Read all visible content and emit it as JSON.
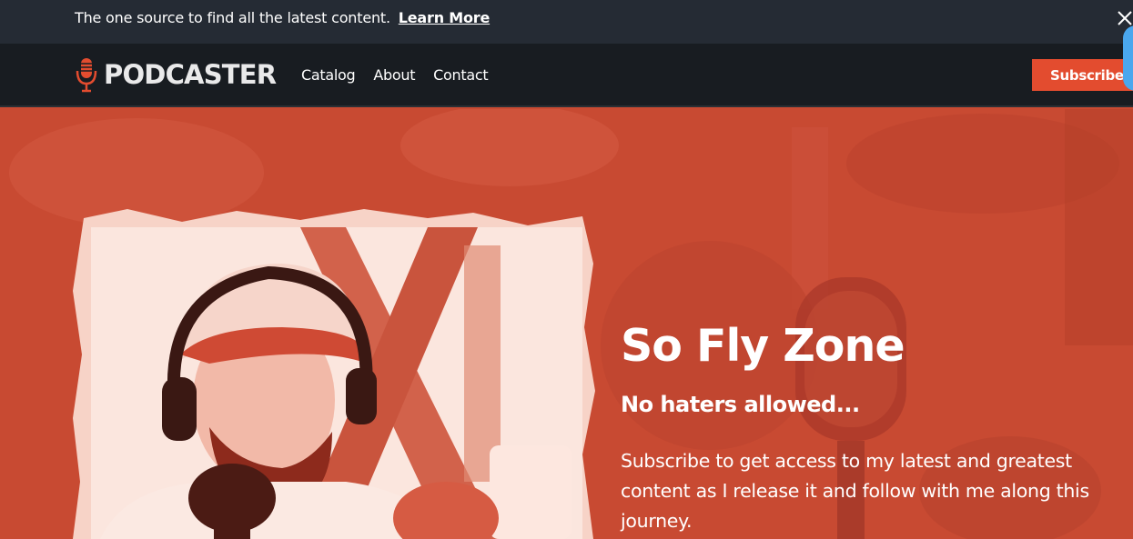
{
  "announcement": {
    "text": "The one source to find all the latest content.",
    "link_label": "Learn More"
  },
  "navbar": {
    "logo_text": "PODCASTER",
    "links": [
      {
        "label": "Catalog"
      },
      {
        "label": "About"
      },
      {
        "label": "Contact"
      }
    ],
    "subscribe_label": "Subscribe"
  },
  "hero": {
    "title": "So Fly Zone",
    "subtitle": "No haters allowed...",
    "body": "Subscribe to get access to my latest and greatest content as I release it and follow with me along this journey."
  },
  "colors": {
    "announcement_bg": "#252b34",
    "navbar_bg": "#181c21",
    "accent": "#e34c2f",
    "hero_bg": "#c84a32",
    "widget_blue": "#4aa7ee"
  },
  "icons": {
    "logo": "microphone-icon",
    "close": "close-icon"
  }
}
